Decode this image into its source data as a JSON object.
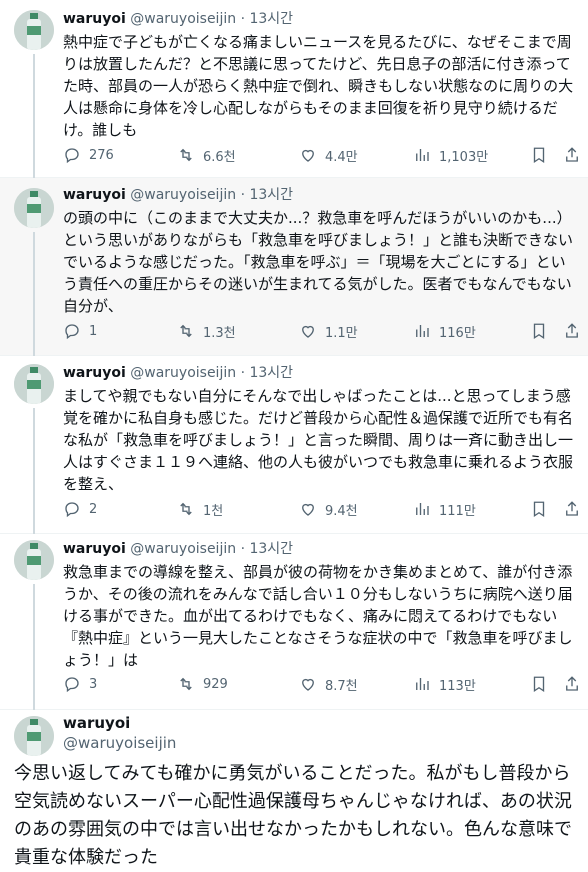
{
  "tweets": [
    {
      "name": "waruyoi",
      "handle": "@waruyoiseijin",
      "sep": "·",
      "time": "13시간",
      "text": "熱中症で子どもが亡くなる痛ましいニュースを見るたびに、なぜそこまで周りは放置したんだ？と不思議に思ってたけど、先日息子の部活に付き添ってた時、部員の一人が恐らく熱中症で倒れ、瞬きもしない状態なのに周りの大人は懸命に身体を冷し心配しながらもそのまま回復を祈り見守り続けるだけ。誰しも",
      "replies": "276",
      "retweets": "6.6천",
      "likes": "4.4만",
      "views": "1,103만"
    },
    {
      "name": "waruyoi",
      "handle": "@waruyoiseijin",
      "sep": "·",
      "time": "13시간",
      "text": "の頭の中に（このままで大丈夫か...？救急車を呼んだほうがいいのかも...）という思いがありながらも「救急車を呼びましょう！」と誰も決断できないでいるような感じだった。「救急車を呼ぶ」＝「現場を大ごとにする」という責任への重圧からその迷いが生まれてる気がした。医者でもなんでもない自分が、",
      "replies": "1",
      "retweets": "1.3천",
      "likes": "1.1만",
      "views": "116만"
    },
    {
      "name": "waruyoi",
      "handle": "@waruyoiseijin",
      "sep": "·",
      "time": "13시간",
      "text": "ましてや親でもない自分にそんなで出しゃばったことは...と思ってしまう感覚を確かに私自身も感じた。だけど普段から心配性＆過保護で近所でも有名な私が「救急車を呼びましょう！」と言った瞬間、周りは一斉に動き出し一人はすぐさま１１９へ連絡、他の人も彼がいつでも救急車に乗れるよう衣服を整え、",
      "replies": "2",
      "retweets": "1천",
      "likes": "9.4천",
      "views": "111만"
    },
    {
      "name": "waruyoi",
      "handle": "@waruyoiseijin",
      "sep": "·",
      "time": "13시간",
      "text": "救急車までの導線を整え、部員が彼の荷物をかき集めまとめて、誰が付き添うか、その後の流れをみんなで話し合い１０分もしないうちに病院へ送り届ける事ができた。血が出てるわけでもなく、痛みに悶えてるわけでもない『熱中症』という一見大したことなさそうな症状の中で「救急車を呼びましょう！」は",
      "replies": "3",
      "retweets": "929",
      "likes": "8.7천",
      "views": "113만"
    }
  ],
  "last": {
    "name": "waruyoi",
    "handle": "@waruyoiseijin",
    "text": "今思い返してみても確かに勇気がいることだった。私がもし普段から空気読めないスーパー心配性過保護母ちゃんじゃなければ、あの状況のあの雰囲気の中では言い出せなかったかもしれない。色んな意味で貴重な体験だった"
  },
  "colors": {
    "text": "#0f1419",
    "muted": "#536471",
    "highlight_bg": "#f7f7f7",
    "thread_line": "#cfd9de"
  },
  "icons": [
    "reply-icon",
    "retweet-icon",
    "like-icon",
    "views-icon",
    "bookmark-icon",
    "share-icon"
  ]
}
